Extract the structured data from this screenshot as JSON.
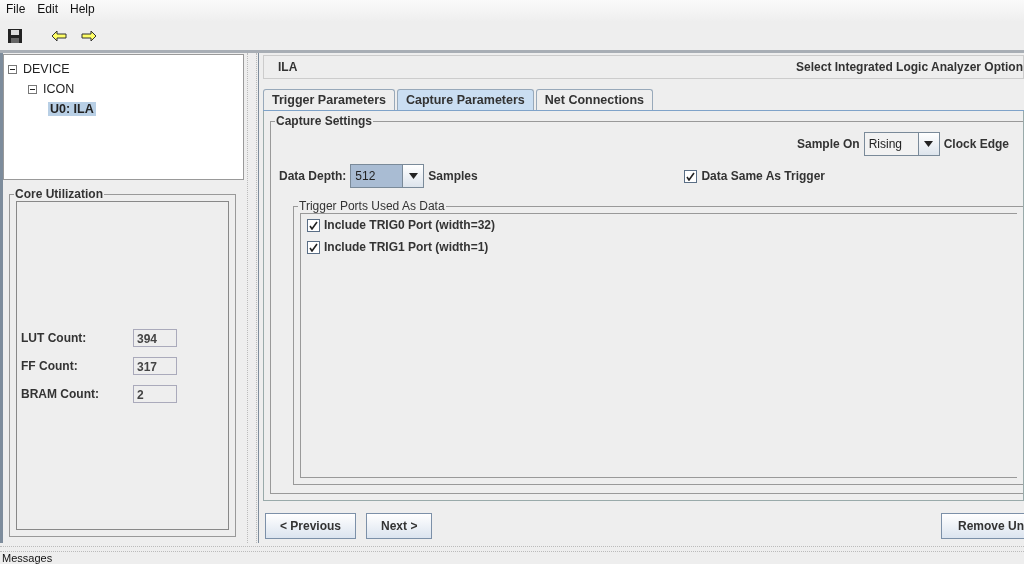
{
  "menu": [
    {
      "label": "File"
    },
    {
      "label": "Edit"
    },
    {
      "label": "Help"
    }
  ],
  "toolbar": [
    {
      "kind": "save"
    },
    {
      "kind": "back"
    },
    {
      "kind": "forward"
    }
  ],
  "tree": [
    {
      "label": "DEVICE",
      "expanded": true,
      "selected": false,
      "children": [
        {
          "label": "ICON",
          "expanded": true,
          "selected": false,
          "children": [
            {
              "label": "U0: ILA",
              "selected": true
            }
          ]
        }
      ]
    }
  ],
  "core_utilization": {
    "title": "Core Utilization",
    "rows": [
      {
        "label": "LUT Count:",
        "value": "394"
      },
      {
        "label": "FF Count:",
        "value": "317"
      },
      {
        "label": "BRAM Count:",
        "value": "2"
      }
    ]
  },
  "header": {
    "title": "ILA",
    "subtitle": "Select Integrated Logic Analyzer Option"
  },
  "tabs": [
    {
      "label": "Trigger Parameters",
      "selected": false
    },
    {
      "label": "Capture Parameters",
      "selected": true
    },
    {
      "label": "Net Connections",
      "selected": false
    }
  ],
  "capture_settings": {
    "title": "Capture Settings",
    "sample_on": {
      "label": "Sample On",
      "value": "Rising",
      "suffix": "Clock Edge"
    },
    "data_depth": {
      "label": "Data Depth:",
      "value": "512",
      "suffix": "Samples"
    },
    "data_same_as_trigger": {
      "label": "Data Same As Trigger",
      "checked": true
    }
  },
  "trigger_ports": {
    "title": "Trigger Ports Used As Data",
    "items": [
      {
        "label": "Include TRIG0 Port (width=32)",
        "checked": true
      },
      {
        "label": "Include TRIG1 Port (width=1)",
        "checked": true
      }
    ]
  },
  "buttons": [
    {
      "label": "< Previous"
    },
    {
      "label": "Next >"
    },
    {
      "label": "Remove Un"
    }
  ],
  "messages": {
    "title": "Messages"
  }
}
